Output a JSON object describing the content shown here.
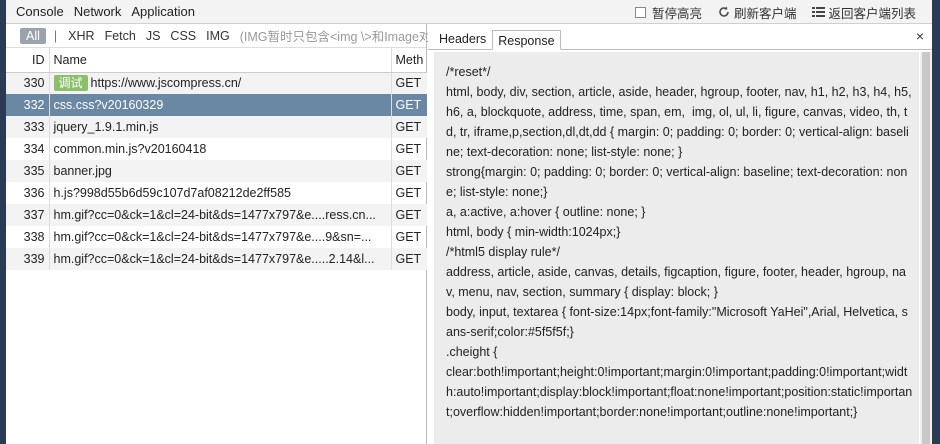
{
  "main_tabs": [
    "Console",
    "Network",
    "Application"
  ],
  "controls": {
    "pause_highlight": "暂停高亮",
    "refresh_client": "刷新客户端",
    "back_to_list": "返回客户端列表"
  },
  "filters": {
    "all": "All",
    "separator": "|",
    "types": [
      "XHR",
      "Fetch",
      "JS",
      "CSS",
      "IMG"
    ],
    "hint": "(IMG暂时只包含<img \\>和Image对象"
  },
  "table": {
    "headers": {
      "id": "ID",
      "name": "Name",
      "method": "Meth"
    },
    "rows": [
      {
        "id": "330",
        "badge": "调试",
        "name": "https://www.jscompress.cn/",
        "method": "GET"
      },
      {
        "id": "332",
        "name": "css.css?v20160329",
        "method": "GET"
      },
      {
        "id": "333",
        "name": "jquery_1.9.1.min.js",
        "method": "GET"
      },
      {
        "id": "334",
        "name": "common.min.js?v20160418",
        "method": "GET"
      },
      {
        "id": "335",
        "name": "banner.jpg",
        "method": "GET"
      },
      {
        "id": "336",
        "name": "h.js?998d55b6d59c107d7af08212de2ff585",
        "method": "GET"
      },
      {
        "id": "337",
        "name": "hm.gif?cc=0&ck=1&cl=24-bit&ds=1477x797&e....ress.cn...",
        "method": "GET"
      },
      {
        "id": "338",
        "name": "hm.gif?cc=0&ck=1&cl=24-bit&ds=1477x797&e....9&sn=...",
        "method": "GET"
      },
      {
        "id": "339",
        "name": "hm.gif?cc=0&ck=1&cl=24-bit&ds=1477x797&e.....2.14&l...",
        "method": "GET"
      }
    ]
  },
  "detail": {
    "tabs": [
      "Headers",
      "Response"
    ],
    "close": "×",
    "response_text": "/*reset*/\nhtml, body, div, section, article, aside, header, hgroup, footer, nav, h1, h2, h3, h4, h5, h6, a, blockquote, address, time, span, em,  img, ol, ul, li, figure, canvas, video, th, td, tr, iframe,p,section,dl,dt,dd { margin: 0; padding: 0; border: 0; vertical-align: baseline; text-decoration: none; list-style: none; }\nstrong{margin: 0; padding: 0; border: 0; vertical-align: baseline; text-decoration: none; list-style: none;}\na, a:active, a:hover { outline: none; }\nhtml, body { min-width:1024px;}\n/*html5 display rule*/\naddress, article, aside, canvas, details, figcaption, figure, footer, header, hgroup, nav, menu, nav, section, summary { display: block; }\nbody, input, textarea { font-size:14px;font-family:\"Microsoft YaHei\",Arial, Helvetica, sans-serif;color:#5f5f5f;}\n.cheight {\nclear:both!important;height:0!important;margin:0!important;padding:0!important;width:auto!important;display:block!important;float:none!important;position:static!important;overflow:hidden!important;border:none!important;outline:none!important;}"
  }
}
